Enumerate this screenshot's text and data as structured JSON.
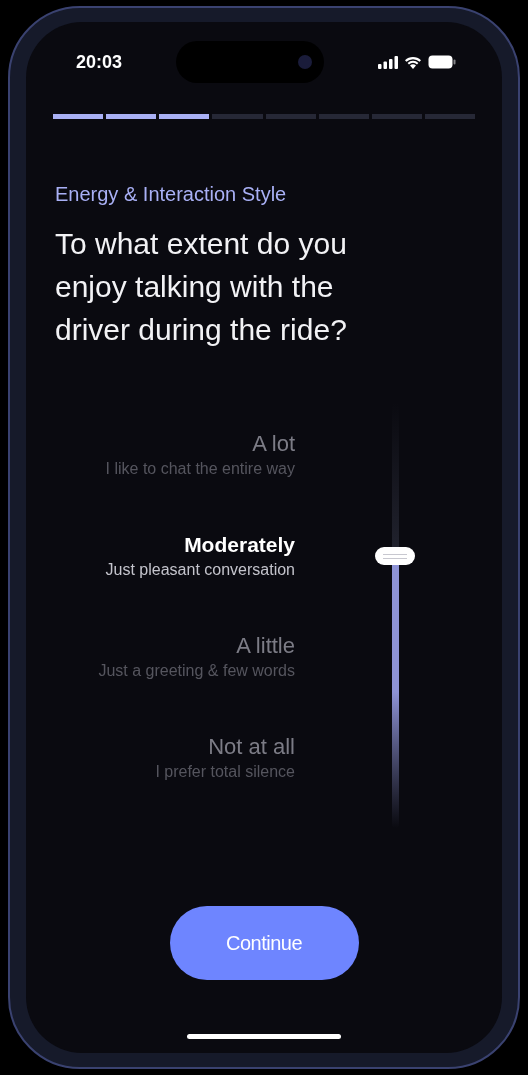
{
  "status_bar": {
    "time": "20:03"
  },
  "progress": [
    {
      "filled": true
    },
    {
      "filled": true
    },
    {
      "filled": true
    },
    {
      "filled": false
    },
    {
      "filled": false
    },
    {
      "filled": false
    },
    {
      "filled": false
    },
    {
      "filled": false
    }
  ],
  "category": "Energy & Interaction Style",
  "question": "To what extent do you enjoy talking with the driver during the ride?",
  "options": [
    {
      "title": "A lot",
      "subtitle": "I like to chat the entire way",
      "selected": false
    },
    {
      "title": "Moderately",
      "subtitle": "Just pleasant conversation",
      "selected": true
    },
    {
      "title": "A little",
      "subtitle": "Just a greeting & few words",
      "selected": false
    },
    {
      "title": "Not at all",
      "subtitle": "I prefer total silence",
      "selected": false
    }
  ],
  "slider": {
    "level": 0.64
  },
  "continue_button": "Continue"
}
